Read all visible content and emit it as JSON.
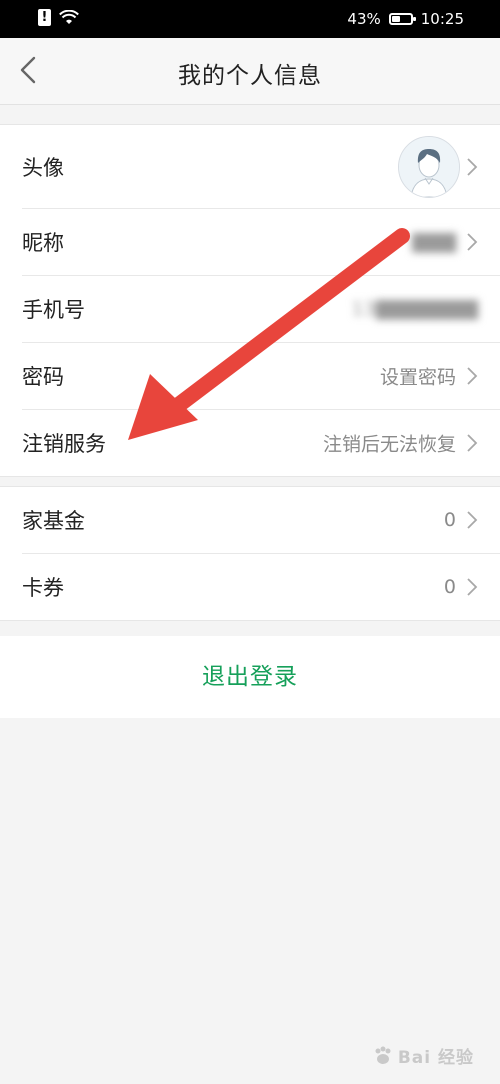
{
  "status_bar": {
    "battery_percent": "43%",
    "battery_level": 0.43,
    "time": "10:25"
  },
  "header": {
    "title": "我的个人信息",
    "back_icon": "chevron-left-icon"
  },
  "profile_group": {
    "rows": [
      {
        "label": "头像",
        "value": ""
      },
      {
        "label": "昵称",
        "value": "▇▇▇"
      },
      {
        "label": "手机号",
        "value": "13▇▇▇▇▇▇▇"
      },
      {
        "label": "密码",
        "value": "设置密码"
      },
      {
        "label": "注销服务",
        "value": "注销后无法恢复"
      }
    ]
  },
  "assets_group": {
    "rows": [
      {
        "label": "家基金",
        "value": "0"
      },
      {
        "label": "卡券",
        "value": "0"
      }
    ]
  },
  "logout_label": "退出登录",
  "annotation": {
    "arrow_color": "#e8453c"
  },
  "watermark": {
    "text": "Bai  经验"
  }
}
